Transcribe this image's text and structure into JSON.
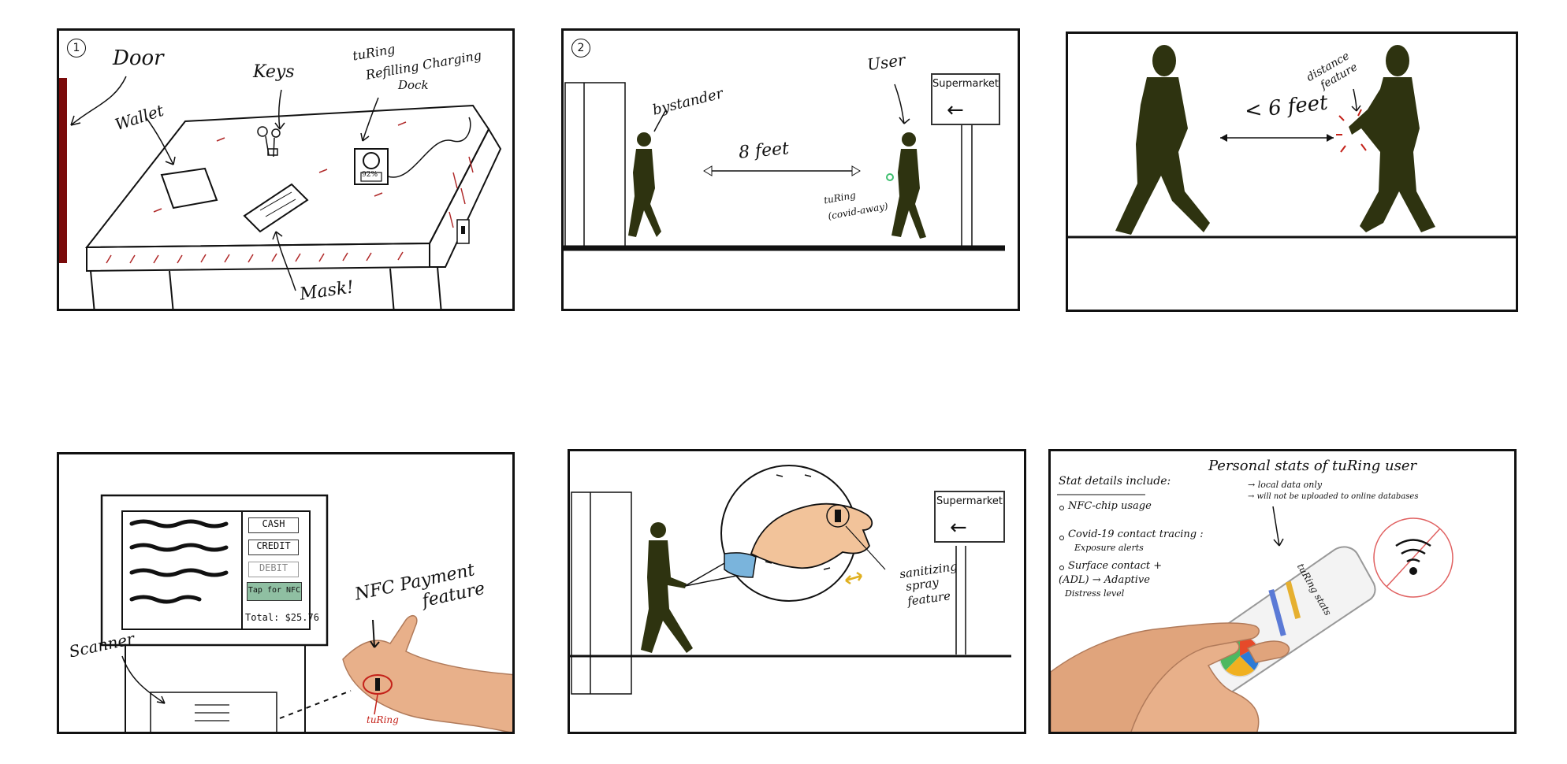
{
  "panels": {
    "p1": {
      "number": "1",
      "door": "Door",
      "wallet": "Wallet",
      "keys": "Keys",
      "dock_line1": "tuRing",
      "dock_line2": "Refilling Charging",
      "dock_line3": "Dock",
      "dock_display": "92%",
      "mask": "Mask!"
    },
    "p2": {
      "number": "2",
      "bystander": "bystander",
      "user": "User",
      "distance": "8 feet",
      "turing_line1": "tuRing",
      "turing_line2": "(covid-away)",
      "sign": "Supermarket"
    },
    "p3": {
      "distance": "< 6 feet",
      "feature_line1": "distance",
      "feature_line2": "feature"
    },
    "p4": {
      "buttons": [
        "CASH",
        "CREDIT",
        "DEBIT",
        "Tap for NFC"
      ],
      "total": "Total: $25.76",
      "nfc_line1": "NFC Payment",
      "nfc_line2": "feature",
      "scanner": "Scanner",
      "turing": "tuRing"
    },
    "p5": {
      "sign": "Supermarket",
      "spray_line1": "sanitizing",
      "spray_line2": "spray",
      "spray_line3": "feature"
    },
    "p6": {
      "heading": "Stat details include:",
      "items": [
        "NFC-chip usage",
        "Covid-19 contact tracing :",
        "Exposure alerts",
        "Surface contact +",
        "(ADL) → Adaptive",
        "Distress level"
      ],
      "title": "Personal stats of tuRing user",
      "note1": "→ local data only",
      "note2": "→ will not be uploaded to online databases",
      "phone_label": "tuRing stats"
    }
  },
  "colors": {
    "silhouette": "#2e3310",
    "door": "#7a0a0a",
    "accent_red": "#c4221a",
    "nfc_green": "#8fbfa2",
    "skin": "#f2c39a",
    "sleeve": "#7ab4dc"
  }
}
